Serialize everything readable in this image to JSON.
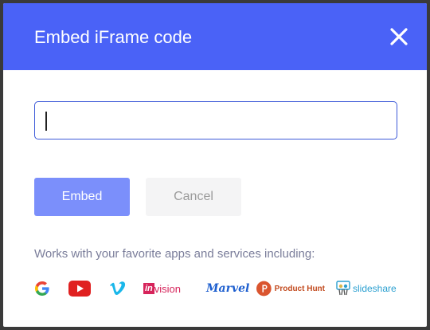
{
  "dialog": {
    "title": "Embed iFrame code",
    "input": {
      "value": "",
      "placeholder": ""
    },
    "embed_label": "Embed",
    "cancel_label": "Cancel",
    "hint": "Works with your favorite apps and services including:"
  },
  "logos": [
    {
      "name": "Google",
      "icon": "google-icon"
    },
    {
      "name": "YouTube",
      "icon": "youtube-icon"
    },
    {
      "name": "Vimeo",
      "icon": "vimeo-icon"
    },
    {
      "name": "invision",
      "icon": "invision-logo"
    },
    {
      "name": "Marvel",
      "icon": "marvel-logo"
    },
    {
      "name": "Product Hunt",
      "icon": "producthunt-logo"
    },
    {
      "name": "slideshare",
      "icon": "slideshare-logo"
    }
  ],
  "colors": {
    "header": "#4a62f7",
    "embed_button": "#7b8ffb",
    "cancel_button": "#f4f4f5",
    "input_border": "#3d5ad8"
  }
}
